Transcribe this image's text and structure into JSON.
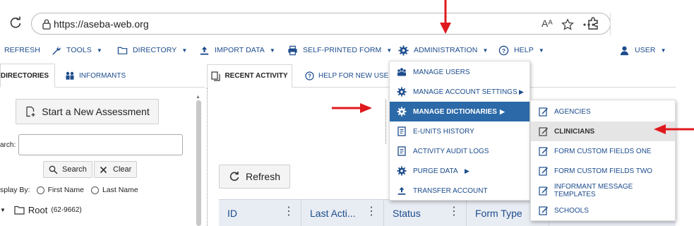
{
  "browser": {
    "url": "https://aseba-web.org",
    "reader_mode_label": "Aᴬ"
  },
  "toolbar": {
    "items": [
      {
        "label": "REFRESH"
      },
      {
        "label": "TOOLS"
      },
      {
        "label": "DIRECTORY"
      },
      {
        "label": "IMPORT DATA"
      },
      {
        "label": "SELF-PRINTED FORM"
      },
      {
        "label": "ADMINISTRATION"
      },
      {
        "label": "HELP"
      },
      {
        "label": "USER"
      }
    ]
  },
  "left_panel": {
    "tabs": [
      {
        "label": "DIRECTORIES",
        "active": true
      },
      {
        "label": "INFORMANTS",
        "active": false
      }
    ],
    "new_assessment_label": "Start a New Assessment",
    "search_label": "arch:",
    "search_value": "",
    "search_button": "Search",
    "clear_button": "Clear",
    "display_by_label": "splay By:",
    "display_options": [
      "First Name",
      "Last Name"
    ],
    "tree_root_label": "Root",
    "tree_root_count": "(62-9662)"
  },
  "main": {
    "tabs": [
      {
        "label": "RECENT ACTIVITY",
        "active": true
      },
      {
        "label": "HELP FOR NEW USERS",
        "active": false
      }
    ],
    "refresh_label": "Refresh",
    "grid_columns": [
      "ID",
      "Last Acti...",
      "Status",
      "Form Type"
    ]
  },
  "admin_menu": {
    "items": [
      {
        "label": "MANAGE USERS",
        "icon": "users-icon",
        "has_submenu": false
      },
      {
        "label": "MANAGE ACCOUNT SETTINGS",
        "icon": "gear-icon",
        "has_submenu": true
      },
      {
        "label": "MANAGE DICTIONARIES",
        "icon": "gear-icon",
        "has_submenu": true,
        "active": true
      },
      {
        "label": "E-UNITS HISTORY",
        "icon": "document-icon",
        "has_submenu": false
      },
      {
        "label": "ACTIVITY AUDIT LOGS",
        "icon": "document-icon",
        "has_submenu": false
      },
      {
        "label": "PURGE DATA",
        "icon": "gear-icon",
        "has_submenu": true
      },
      {
        "label": "TRANSFER ACCOUNT",
        "icon": "upload-icon",
        "has_submenu": false
      }
    ]
  },
  "dictionaries_menu": {
    "items": [
      {
        "label": "AGENCIES"
      },
      {
        "label": "CLINICIANS",
        "hover": true
      },
      {
        "label": "FORM CUSTOM FIELDS ONE"
      },
      {
        "label": "FORM CUSTOM FIELDS TWO"
      },
      {
        "label": "INFORMANT MESSAGE TEMPLATES"
      },
      {
        "label": "SCHOOLS"
      }
    ]
  },
  "colors": {
    "link_blue": "#1c4c8c",
    "menu_active": "#2b69a8",
    "annotation_red": "#e0191e",
    "grid_header": "#e8ecf3"
  }
}
